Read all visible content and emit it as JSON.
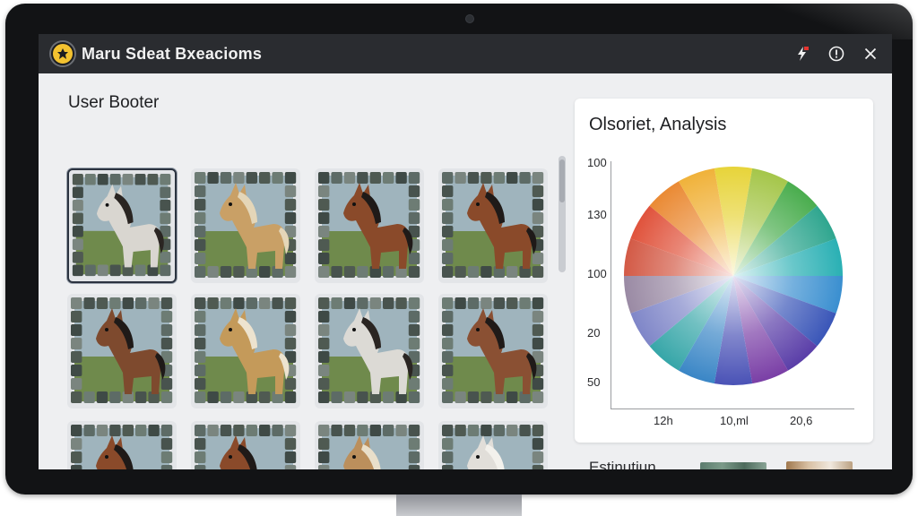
{
  "window": {
    "title": "Maru Sdeat Bxeacioms",
    "actions": [
      {
        "name": "flash-icon"
      },
      {
        "name": "info-icon"
      },
      {
        "name": "close-icon"
      }
    ]
  },
  "left": {
    "title": "User Booter",
    "thumbnails": [
      {
        "coat": "#d9d6d0",
        "mane": "#2a2522",
        "selected": true
      },
      {
        "coat": "#c9a066",
        "mane": "#e4d6b8",
        "selected": false
      },
      {
        "coat": "#8a4a2a",
        "mane": "#1f1a18",
        "selected": false
      },
      {
        "coat": "#8a4a2a",
        "mane": "#1f1a18",
        "selected": false
      },
      {
        "coat": "#7e4a2e",
        "mane": "#1f1a18",
        "selected": false
      },
      {
        "coat": "#c49a5a",
        "mane": "#ede3cf",
        "selected": false
      },
      {
        "coat": "#dcdad5",
        "mane": "#2a2522",
        "selected": false
      },
      {
        "coat": "#8a5033",
        "mane": "#1f1a18",
        "selected": false
      },
      {
        "coat": "#8a4a2a",
        "mane": "#1f1a18",
        "selected": false
      },
      {
        "coat": "#8a4a2a",
        "mane": "#1f1a18",
        "selected": false
      },
      {
        "coat": "#bb8f5c",
        "mane": "#e9dfca",
        "selected": false
      },
      {
        "coat": "#e1ded9",
        "mane": "#f3f1ec",
        "selected": false
      }
    ]
  },
  "analysis": {
    "title": "Olsoriet, Analysis",
    "y_labels": [
      "100",
      "130",
      "100",
      "20",
      "50"
    ],
    "x_labels": [
      "12h",
      "10,ml",
      "20,6"
    ],
    "wheel_colors": [
      "#e7d43a",
      "#a5c64a",
      "#4aad4e",
      "#2fa68f",
      "#2ab0b4",
      "#3a8fd0",
      "#3a56b8",
      "#5a3ea8",
      "#7a3fa6",
      "#4a52b6",
      "#3a86c6",
      "#36a6a8",
      "#7f86c8",
      "#9a8aa4",
      "#d35a46",
      "#e0533c",
      "#ea8a34",
      "#f0b23a"
    ]
  },
  "bottom": {
    "label": "Estinutiun"
  }
}
